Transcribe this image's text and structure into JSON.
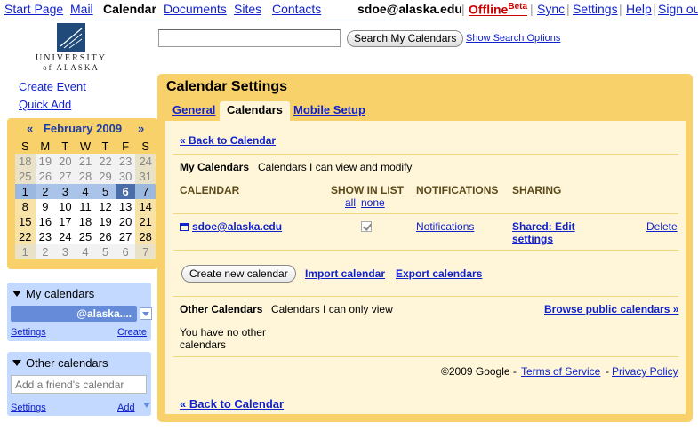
{
  "topnav": {
    "items": [
      "Start Page",
      "Mail",
      "Calendar",
      "Documents",
      "Sites",
      "Contacts"
    ],
    "user": "sdoe@alaska.edu",
    "offline": "Offline",
    "offline_sup": "Beta",
    "links": [
      "Sync",
      "Settings",
      "Help",
      "Sign out"
    ],
    "separator": "|"
  },
  "logo": {
    "line1": "UNIVERSITY",
    "line2": "of ALASKA"
  },
  "search": {
    "input_value": "",
    "button_label": "Search My Calendars",
    "options_link": "Show Search Options"
  },
  "leftnav": {
    "create_event": "Create Event",
    "quick_add": "Quick Add"
  },
  "minical": {
    "prev": "«",
    "next": "»",
    "title": "February 2009",
    "dows": [
      "S",
      "M",
      "T",
      "W",
      "T",
      "F",
      "S"
    ],
    "weeks": [
      [
        "18",
        "19",
        "20",
        "21",
        "22",
        "23",
        "24"
      ],
      [
        "25",
        "26",
        "27",
        "28",
        "29",
        "30",
        "31"
      ],
      [
        "1",
        "2",
        "3",
        "4",
        "5",
        "6",
        "7"
      ],
      [
        "8",
        "9",
        "10",
        "11",
        "12",
        "13",
        "14"
      ],
      [
        "15",
        "16",
        "17",
        "18",
        "19",
        "20",
        "21"
      ],
      [
        "22",
        "23",
        "24",
        "25",
        "26",
        "27",
        "28"
      ],
      [
        "1",
        "2",
        "3",
        "4",
        "5",
        "6",
        "7"
      ]
    ],
    "today": "6"
  },
  "my_calendars": {
    "header": "My calendars",
    "chip": "@alaska....",
    "settings": "Settings",
    "create": "Create"
  },
  "other_calendars": {
    "header": "Other calendars",
    "placeholder": "Add a friend's calendar",
    "settings": "Settings",
    "add": "Add"
  },
  "settings": {
    "title": "Calendar Settings",
    "tabs": [
      "General",
      "Calendars",
      "Mobile Setup"
    ],
    "back_link": "« Back to Calendar",
    "my_cals_label": "My Calendars",
    "my_cals_desc": "Calendars I can view and modify",
    "columns": {
      "calendar": "CALENDAR",
      "show": "SHOW IN LIST",
      "notifications": "NOTIFICATIONS",
      "sharing": "SHARING"
    },
    "show_all": "all",
    "show_none": "none",
    "row": {
      "name": "sdoe@alaska.edu",
      "notifications": "Notifications",
      "sharing_line1": "Shared: Edit",
      "sharing_line2": "settings",
      "delete": "Delete"
    },
    "create_btn": "Create new calendar",
    "import_link": "Import calendar",
    "export_link": "Export calendars",
    "other_label": "Other Calendars",
    "other_desc": "Calendars I can only view",
    "browse_link": "Browse public calendars »",
    "no_other_line1": "You have no other",
    "no_other_line2": "calendars",
    "copyright": "©2009 Google -",
    "tos": "Terms of Service",
    "dash": "-",
    "privacy": "Privacy Policy"
  },
  "colors": {
    "panel": "#f9d16a",
    "inner": "#fff6d9",
    "link": "#1122cc",
    "offline": "#cc0000",
    "sidebox": "#c3d9ff"
  }
}
